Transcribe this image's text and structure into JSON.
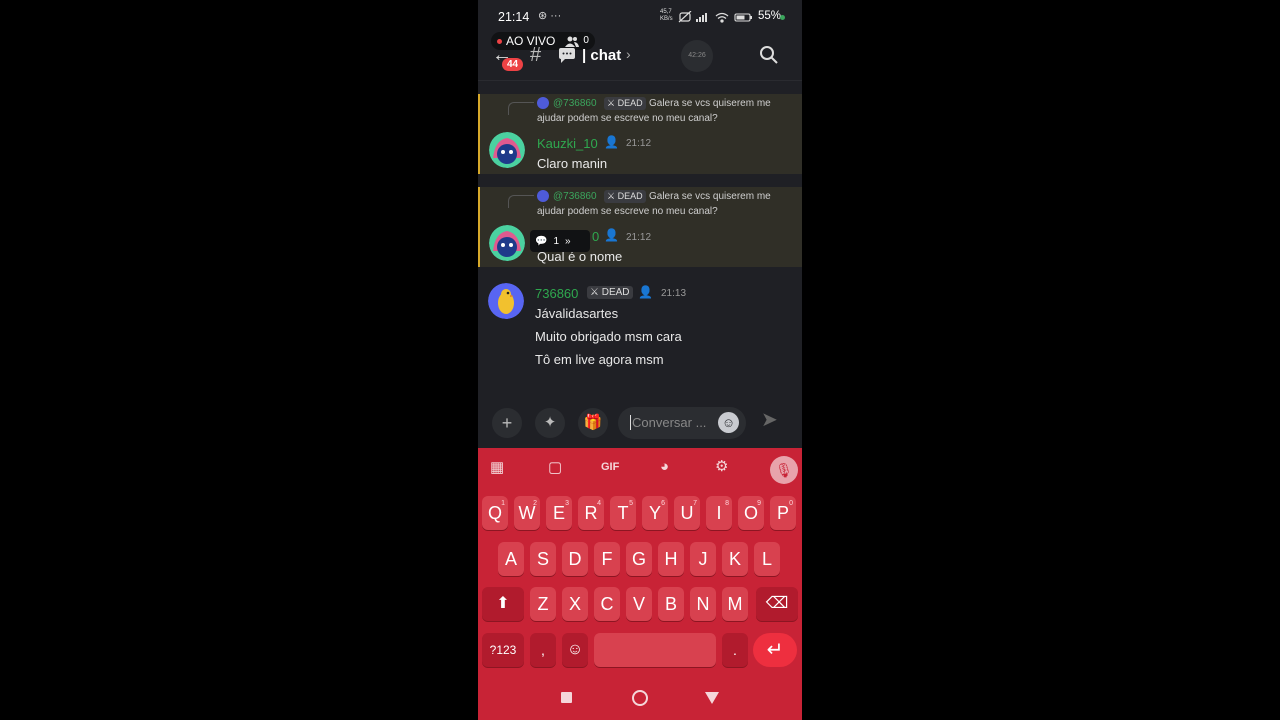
{
  "status_bar": {
    "time": "21:14",
    "left_icons": "⊛ ···",
    "speed": "45,7 KB/s",
    "battery": "55%"
  },
  "live": {
    "label": "AO VIVO",
    "viewers": "0"
  },
  "header": {
    "back_icon": "arrow-left-icon",
    "unread_badge": "44",
    "channel_name": "| chat",
    "timer": "42:26",
    "search_icon": "search-icon"
  },
  "messages": [
    {
      "highlighted": true,
      "reply": {
        "user": "@736860",
        "tag": "DEAD",
        "text_line1": "Galera se vcs quiserem me",
        "text_line2": "ajudar podem se escreve no meu canal?"
      },
      "username": "Kauzki_10",
      "time": "21:12",
      "lines": [
        "Claro manin"
      ]
    },
    {
      "highlighted": true,
      "reply": {
        "user": "@736860",
        "tag": "DEAD",
        "text_line1": "Galera se vcs quiserem me",
        "text_line2": "ajudar podem se escreve no meu canal?"
      },
      "username": "0",
      "time": "21:12",
      "lines": [
        "Qual é o nome"
      ],
      "thread_count": "1"
    },
    {
      "highlighted": false,
      "username": "736860",
      "tag": "DEAD",
      "time": "21:13",
      "lines": [
        "Jávalidasartes",
        "Muito obrigado msm cara",
        "Tô em live agora msm"
      ]
    }
  ],
  "composer": {
    "placeholder": "Conversar ..."
  },
  "keyboard": {
    "toolbar": {
      "gif": "GIF"
    },
    "row1": [
      "Q",
      "W",
      "E",
      "R",
      "T",
      "Y",
      "U",
      "I",
      "O",
      "P"
    ],
    "row1_hints": [
      "1",
      "2",
      "3",
      "4",
      "5",
      "6",
      "7",
      "8",
      "9",
      "0"
    ],
    "row2": [
      "A",
      "S",
      "D",
      "F",
      "G",
      "H",
      "J",
      "K",
      "L"
    ],
    "row3": [
      "Z",
      "X",
      "C",
      "V",
      "B",
      "N",
      "M"
    ],
    "symbols_label": "?123",
    "comma": ",",
    "period": "."
  },
  "colors": {
    "keyboard_bg": "#c82336",
    "key_bg": "#d8414f",
    "highlight_border": "#d7a92a",
    "username_green": "#2fa84f"
  }
}
